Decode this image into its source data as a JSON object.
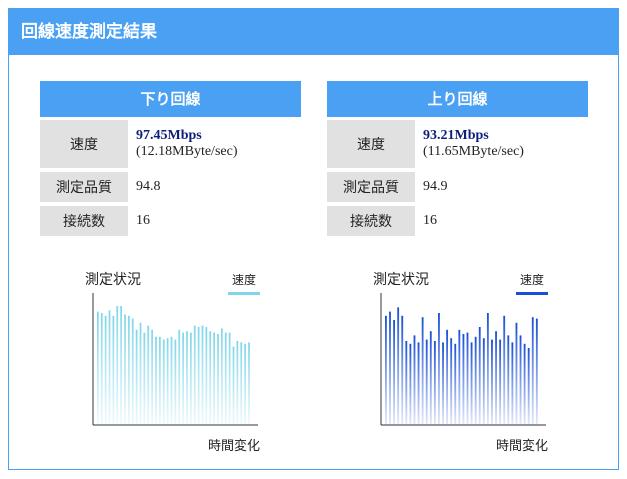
{
  "header": {
    "title": "回線速度測定結果"
  },
  "down": {
    "title": "下り回線",
    "speed_label": "速度",
    "speed_mbps": "97.45Mbps",
    "speed_mbyte": "(12.18MByte/sec)",
    "quality_label": "測定品質",
    "quality": "94.8",
    "conn_label": "接続数",
    "connections": "16",
    "chart": {
      "title": "測定状況",
      "legend": "速度",
      "xlabel": "時間変化",
      "color": "#7fd6ea",
      "bar_values": [
        0.81,
        0.8,
        0.78,
        0.82,
        0.78,
        0.85,
        0.85,
        0.79,
        0.78,
        0.76,
        0.68,
        0.73,
        0.66,
        0.71,
        0.68,
        0.63,
        0.63,
        0.61,
        0.62,
        0.63,
        0.61,
        0.68,
        0.66,
        0.67,
        0.66,
        0.71,
        0.7,
        0.71,
        0.7,
        0.67,
        0.66,
        0.65,
        0.69,
        0.66,
        0.66,
        0.56,
        0.6,
        0.59,
        0.58,
        0.59
      ]
    }
  },
  "up": {
    "title": "上り回線",
    "speed_label": "速度",
    "speed_mbps": "93.21Mbps",
    "speed_mbyte": "(11.65MByte/sec)",
    "quality_label": "測定品質",
    "quality": "94.9",
    "conn_label": "接続数",
    "connections": "16",
    "chart": {
      "title": "測定状況",
      "legend": "速度",
      "xlabel": "時間変化",
      "color": "#1a4fd6",
      "bar_values": [
        0.78,
        0.81,
        0.75,
        0.84,
        0.78,
        0.6,
        0.58,
        0.64,
        0.59,
        0.77,
        0.61,
        0.67,
        0.6,
        0.8,
        0.59,
        0.68,
        0.62,
        0.58,
        0.68,
        0.65,
        0.66,
        0.59,
        0.63,
        0.7,
        0.62,
        0.8,
        0.61,
        0.67,
        0.61,
        0.78,
        0.64,
        0.59,
        0.73,
        0.64,
        0.58,
        0.55,
        0.77,
        0.76
      ]
    }
  }
}
